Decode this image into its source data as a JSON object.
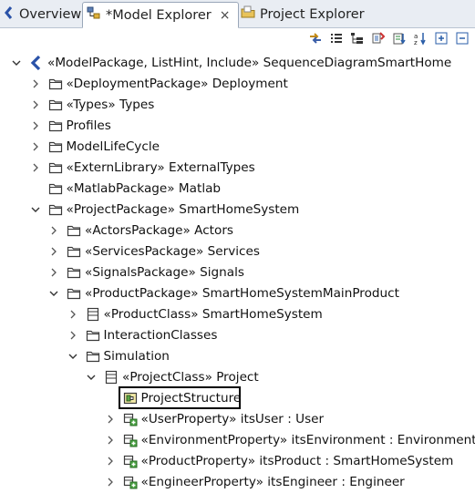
{
  "tabs": [
    {
      "label": "Overview",
      "icon": "overview-icon"
    },
    {
      "label": "*Model Explorer",
      "icon": "model-explorer-icon",
      "close": "×"
    },
    {
      "label": "Project Explorer",
      "icon": "project-explorer-icon"
    }
  ],
  "toolbar": [
    {
      "name": "link-with-editor-icon"
    },
    {
      "name": "show-list-icon"
    },
    {
      "name": "show-tree-icon"
    },
    {
      "name": "filter-icon"
    },
    {
      "name": "view-menu-icon"
    },
    {
      "name": "sort-alphabetical-icon"
    },
    {
      "name": "expand-all-icon"
    },
    {
      "name": "collapse-all-icon"
    }
  ],
  "tree": [
    {
      "label": "«ModelPackage, ListHint, Include» SequenceDiagramSmartHome",
      "icon": "model-icon",
      "depth": 0,
      "twisty": "expanded"
    },
    {
      "label": "«DeploymentPackage» Deployment",
      "icon": "folder-icon",
      "depth": 1,
      "twisty": "collapsed"
    },
    {
      "label": "«Types» Types",
      "icon": "folder-icon",
      "depth": 1,
      "twisty": "collapsed"
    },
    {
      "label": "Profiles",
      "icon": "folder-icon",
      "depth": 1,
      "twisty": "collapsed"
    },
    {
      "label": "ModelLifeCycle",
      "icon": "folder-icon",
      "depth": 1,
      "twisty": "collapsed"
    },
    {
      "label": "«ExternLibrary» ExternalTypes",
      "icon": "folder-icon",
      "depth": 1,
      "twisty": "collapsed"
    },
    {
      "label": "«MatlabPackage» Matlab",
      "icon": "folder-icon",
      "depth": 1,
      "twisty": "none"
    },
    {
      "label": "«ProjectPackage» SmartHomeSystem",
      "icon": "folder-icon",
      "depth": 1,
      "twisty": "expanded"
    },
    {
      "label": "«ActorsPackage» Actors",
      "icon": "folder-icon",
      "depth": 2,
      "twisty": "collapsed"
    },
    {
      "label": "«ServicesPackage» Services",
      "icon": "folder-icon",
      "depth": 2,
      "twisty": "collapsed"
    },
    {
      "label": "«SignalsPackage» Signals",
      "icon": "folder-icon",
      "depth": 2,
      "twisty": "collapsed"
    },
    {
      "label": "«ProductPackage» SmartHomeSystemMainProduct",
      "icon": "folder-icon",
      "depth": 2,
      "twisty": "expanded"
    },
    {
      "label": "«ProductClass» SmartHomeSystem",
      "icon": "class-icon",
      "depth": 3,
      "twisty": "collapsed"
    },
    {
      "label": "InteractionClasses",
      "icon": "folder-icon",
      "depth": 3,
      "twisty": "collapsed"
    },
    {
      "label": "Simulation",
      "icon": "folder-icon",
      "depth": 3,
      "twisty": "expanded"
    },
    {
      "label": "«ProjectClass» Project",
      "icon": "class-icon",
      "depth": 4,
      "twisty": "expanded"
    },
    {
      "label": "ProjectStructure",
      "icon": "structure-diagram-icon",
      "depth": 5,
      "twisty": "none",
      "selected": true
    },
    {
      "label": "«UserProperty» itsUser : User",
      "icon": "property-icon",
      "depth": 5,
      "twisty": "collapsed"
    },
    {
      "label": "«EnvironmentProperty» itsEnvironment : Environment",
      "icon": "property-icon",
      "depth": 5,
      "twisty": "collapsed"
    },
    {
      "label": "«ProductProperty» itsProduct : SmartHomeSystem",
      "icon": "property-icon",
      "depth": 5,
      "twisty": "collapsed"
    },
    {
      "label": "«EngineerProperty» itsEngineer : Engineer",
      "icon": "property-icon",
      "depth": 5,
      "twisty": "collapsed"
    }
  ],
  "colors": {
    "tabbar": "#e9edf3",
    "folder": "#3a3a3a",
    "selection_border": "#000000"
  }
}
